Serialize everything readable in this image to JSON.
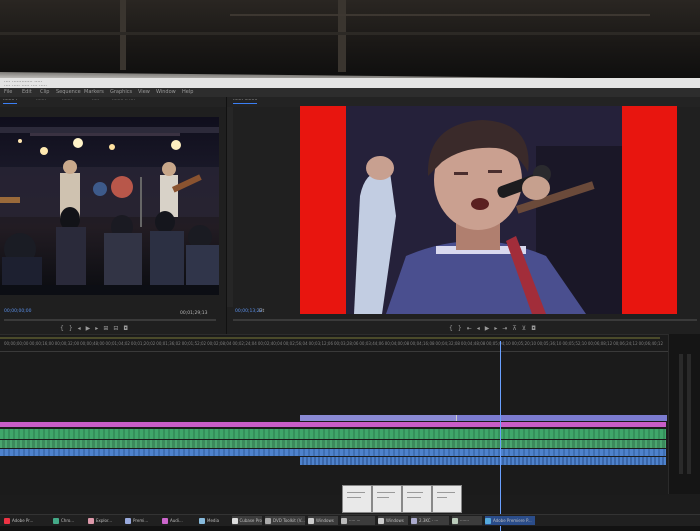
{
  "app": {
    "title_lines": [
      "···· ············· ·····",
      "···· ····· ····· ···· ·····"
    ],
    "menu_items": [
      "File",
      "Edit",
      "Clip",
      "Sequence",
      "Markers",
      "Graphics",
      "View",
      "Window",
      "Help"
    ]
  },
  "source_monitor": {
    "tabs": [
      "········ ·",
      "·······",
      "·······",
      "·····",
      "········ ·· ····"
    ],
    "timecode_left": "00;00;00;00",
    "timecode_right": "00;01;29;13"
  },
  "program_monitor": {
    "tabs": [
      "·······  ·········"
    ],
    "timecode_left": "00;00;13;22",
    "fit_label": "Fit",
    "colors": {
      "letterbox": "#e8150f"
    }
  },
  "timeline": {
    "ruler_ticks": [
      "00;00;00;00",
      "00;00;16;00",
      "00;00;32;00",
      "00;00;48;00",
      "00;01;04;02",
      "00;01;20;02",
      "00;01;36;02",
      "00;01;52;02",
      "00;02;08;04",
      "00;02;24;04",
      "00;02;40;04",
      "00;02;56;04",
      "00;03;12;06",
      "00;03;28;06",
      "00;03;44;06",
      "00;04;00;08",
      "00;04;16;08",
      "00;04;32;08",
      "00;04;48;08",
      "00;05;04;10",
      "00;05;20;10",
      "00;05;36;10",
      "00;05;52;10",
      "00;06;08;12",
      "00;06;24;12",
      "00;06;40;12"
    ],
    "colors": {
      "video": "#8a8ad4",
      "pink": "#c85dc7",
      "audio_green": "#3fa66a",
      "audio_blue": "#4e82cc",
      "playhead": "#6aa0ff"
    }
  },
  "taskbar": {
    "items": [
      {
        "icon": "adobe-icon",
        "label": "Adobe Pr..."
      },
      {
        "icon": "chrome-icon",
        "label": "Chro..."
      },
      {
        "icon": "folder-icon",
        "label": "Explor..."
      },
      {
        "icon": "premiere-icon",
        "label": "Premi..."
      },
      {
        "icon": "audition-icon",
        "label": "Audi..."
      },
      {
        "icon": "media-icon",
        "label": "Media"
      },
      {
        "icon": "window-icon",
        "label": "Cubase Pro"
      },
      {
        "icon": "window-icon",
        "label": "DVD Toolkit (V..."
      },
      {
        "icon": "window-icon",
        "label": "Windows"
      },
      {
        "icon": "window-icon",
        "label": "····· ···"
      },
      {
        "icon": "window-icon",
        "label": "Windows"
      },
      {
        "icon": "window-icon",
        "label": "2.3KC · ···"
      },
      {
        "icon": "window-icon",
        "label": "·······"
      },
      {
        "icon": "premiere-icon",
        "label": "Adobe Premiere P..."
      }
    ]
  }
}
